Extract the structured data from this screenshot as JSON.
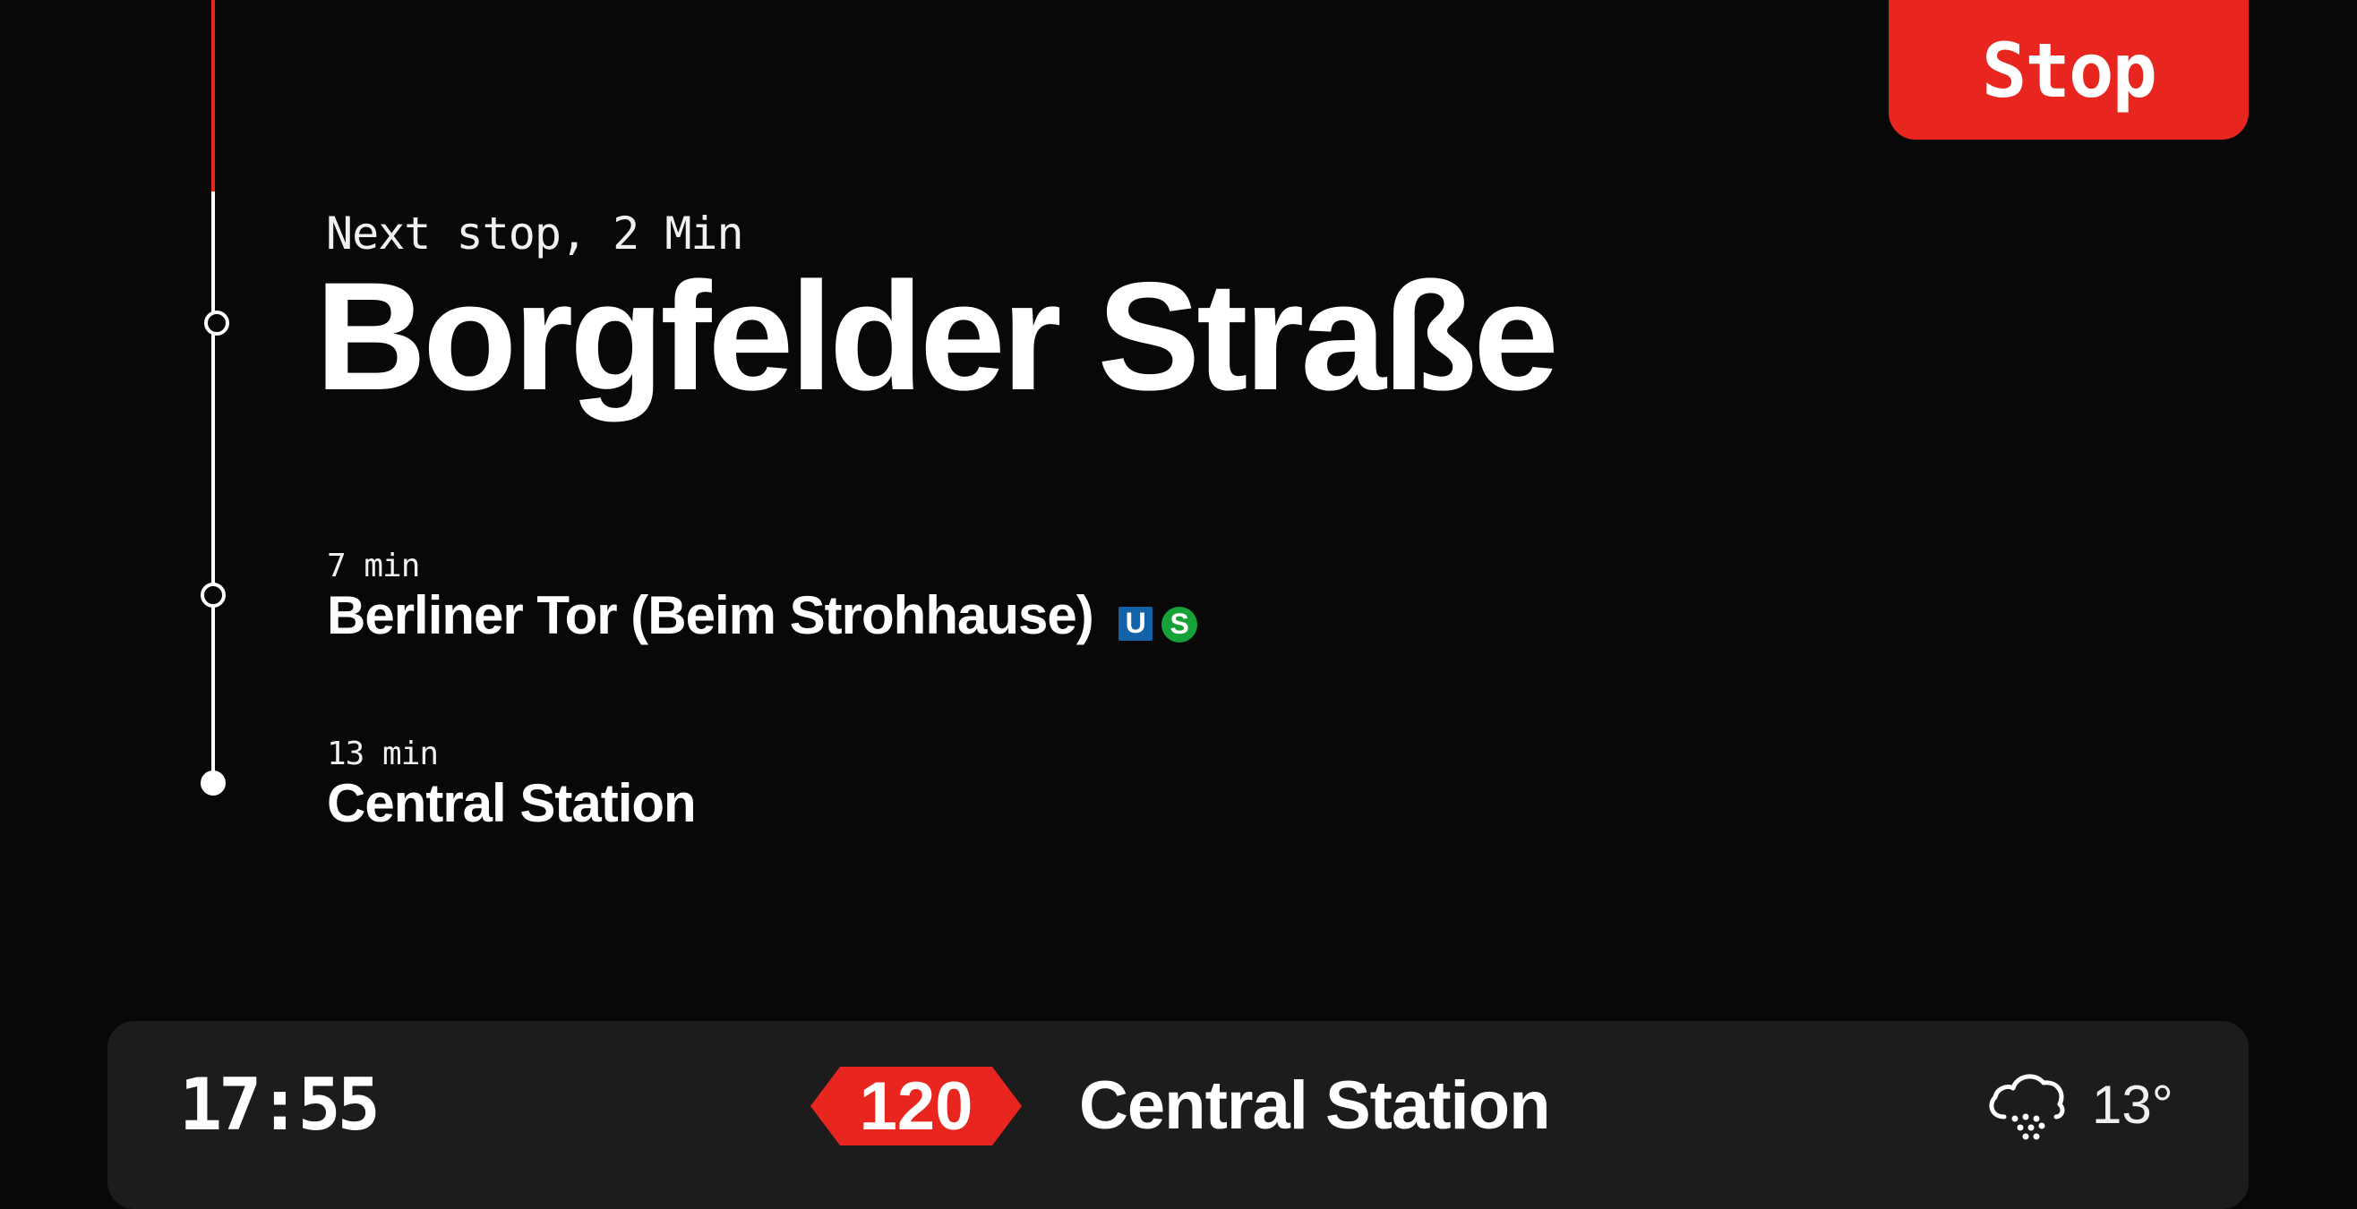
{
  "stop_button": {
    "label": "Stop"
  },
  "next_stop": {
    "label": "Next stop, 2 Min",
    "name": "Borgfelder Straße"
  },
  "upcoming": [
    {
      "eta": "7 min",
      "name": "Berliner Tor (Beim Strohhause)",
      "badges": [
        "U",
        "S"
      ]
    },
    {
      "eta": "13 min",
      "name": "Central Station"
    }
  ],
  "bottom_bar": {
    "time": "17:55",
    "route": "120",
    "destination": "Central Station",
    "weather_icon": "snow-cloud-icon",
    "temperature": "13°"
  },
  "colors": {
    "background": "#080808",
    "accent": "#e8261f",
    "bar": "#1c1c1c",
    "u_bahn": "#1462a8",
    "s_bahn": "#16a238"
  }
}
